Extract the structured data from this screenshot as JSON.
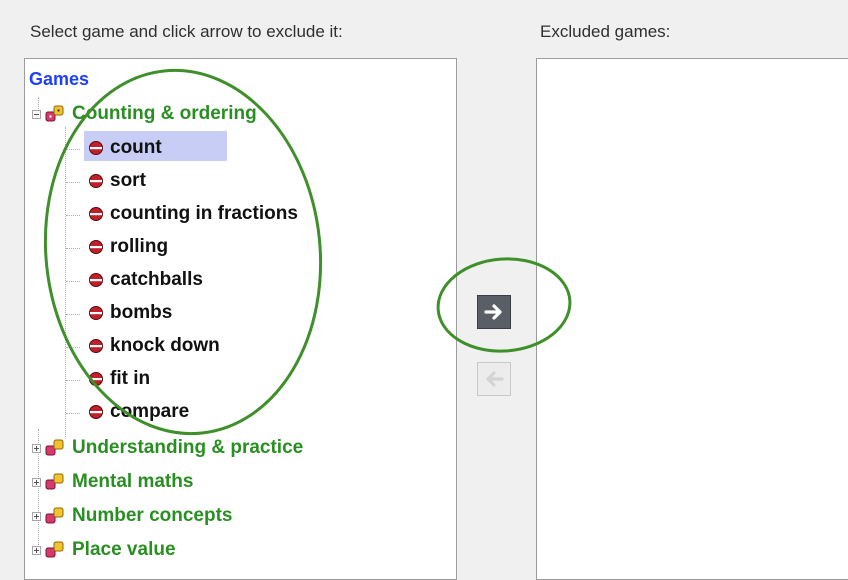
{
  "labels": {
    "select_instruction": "Select game and click arrow to exclude it:",
    "excluded_title": "Excluded games:"
  },
  "tree": {
    "root": "Games",
    "categories": [
      {
        "label": "Counting & ordering",
        "expanded": true,
        "games": [
          "count",
          "sort",
          "counting in fractions",
          "rolling",
          "catchballs",
          "bombs",
          "knock down",
          "fit in",
          "compare"
        ],
        "selected": "count"
      },
      {
        "label": "Understanding & practice",
        "expanded": false
      },
      {
        "label": "Mental maths",
        "expanded": false
      },
      {
        "label": "Number concepts",
        "expanded": false
      },
      {
        "label": "Place value",
        "expanded": false
      }
    ]
  },
  "buttons": {
    "exclude_icon": "arrow-right-icon",
    "include_icon": "arrow-left-icon",
    "include_enabled": false
  },
  "colors": {
    "root": "#1f3fff",
    "category": "#2a8f22",
    "selection": "#c8cdf5",
    "annotation": "#3f8f2a"
  }
}
